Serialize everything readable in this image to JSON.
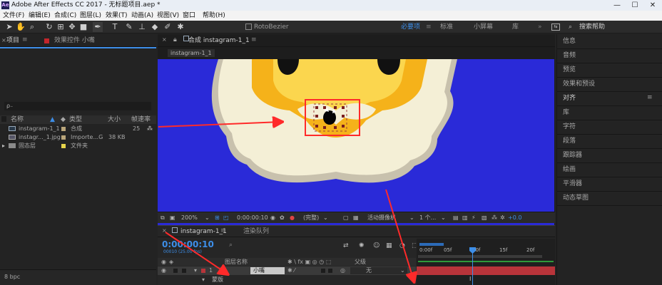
{
  "window": {
    "app_icon": "Ae",
    "title": "Adobe After Effects CC 2017 - 无标题项目.aep *",
    "minimize": "—",
    "maximize": "☐",
    "close": "✕"
  },
  "menu": [
    "文件(F)",
    "编辑(E)",
    "合成(C)",
    "图层(L)",
    "效果(T)",
    "动画(A)",
    "视图(V)",
    "窗口",
    "帮助(H)"
  ],
  "toolbar": {
    "rotobezier_label": "RotoBezier",
    "workspaces": [
      "必要项",
      "标准",
      "小屏幕",
      "库"
    ],
    "active_workspace": "必要项",
    "search_placeholder": "搜索帮助"
  },
  "project_panel": {
    "tab_project": "项目",
    "tab_effects": "效果控件 小嘴",
    "search_placeholder": "ρ₋",
    "columns": [
      "名称",
      "类型",
      "大小",
      "帧速率"
    ],
    "items": [
      {
        "name": "instagram-1_1",
        "type": "合成",
        "size": "",
        "fps": "25",
        "color": "#b9a57a",
        "icon": "composition-icon"
      },
      {
        "name": "instagr..._1.jpg",
        "type": "Importe...G",
        "size": "38 KB",
        "fps": "",
        "color": "#b9a57a",
        "icon": "image-icon"
      },
      {
        "name": "固态层",
        "type": "文件夹",
        "size": "",
        "fps": "",
        "color": "#e6d44b",
        "icon": "folder-icon"
      }
    ],
    "bpc": "8 bpc"
  },
  "comp_panel": {
    "tab_title": "合成 instagram-1_1",
    "breadcrumb": "instagram-1_1"
  },
  "viewer_bar": {
    "zoom": "200%",
    "timecode": "0:00:00:10",
    "resolution": "(完整)",
    "camera": "活动摄像机",
    "views": "1 个...",
    "exposure": "+0.0"
  },
  "timeline": {
    "tab_comp": "instagram-1_1",
    "tab_render": "渲染队列",
    "current_time": "0:00:00:10",
    "frame_info": "00010 (25.00 fps)",
    "col_layer_name": "图层名称",
    "col_parent": "父级",
    "ruler": [
      "0:00f",
      "05f",
      "10f",
      "15f",
      "20f"
    ],
    "layer_number": "1",
    "layer_name": "小嘴",
    "parent_value": "无",
    "mask_label": "蒙版"
  },
  "right_panel": {
    "items": [
      "信息",
      "音频",
      "预览",
      "效果和预设",
      "对齐",
      "库",
      "字符",
      "段落",
      "跟踪器",
      "绘画",
      "平滑器",
      "动态草图"
    ]
  },
  "colors": {
    "accent": "#3d8ee8",
    "viewer_bg": "#2a2ad8",
    "annotation": "#ff2a2a",
    "layer_bar": "#b8343a"
  }
}
